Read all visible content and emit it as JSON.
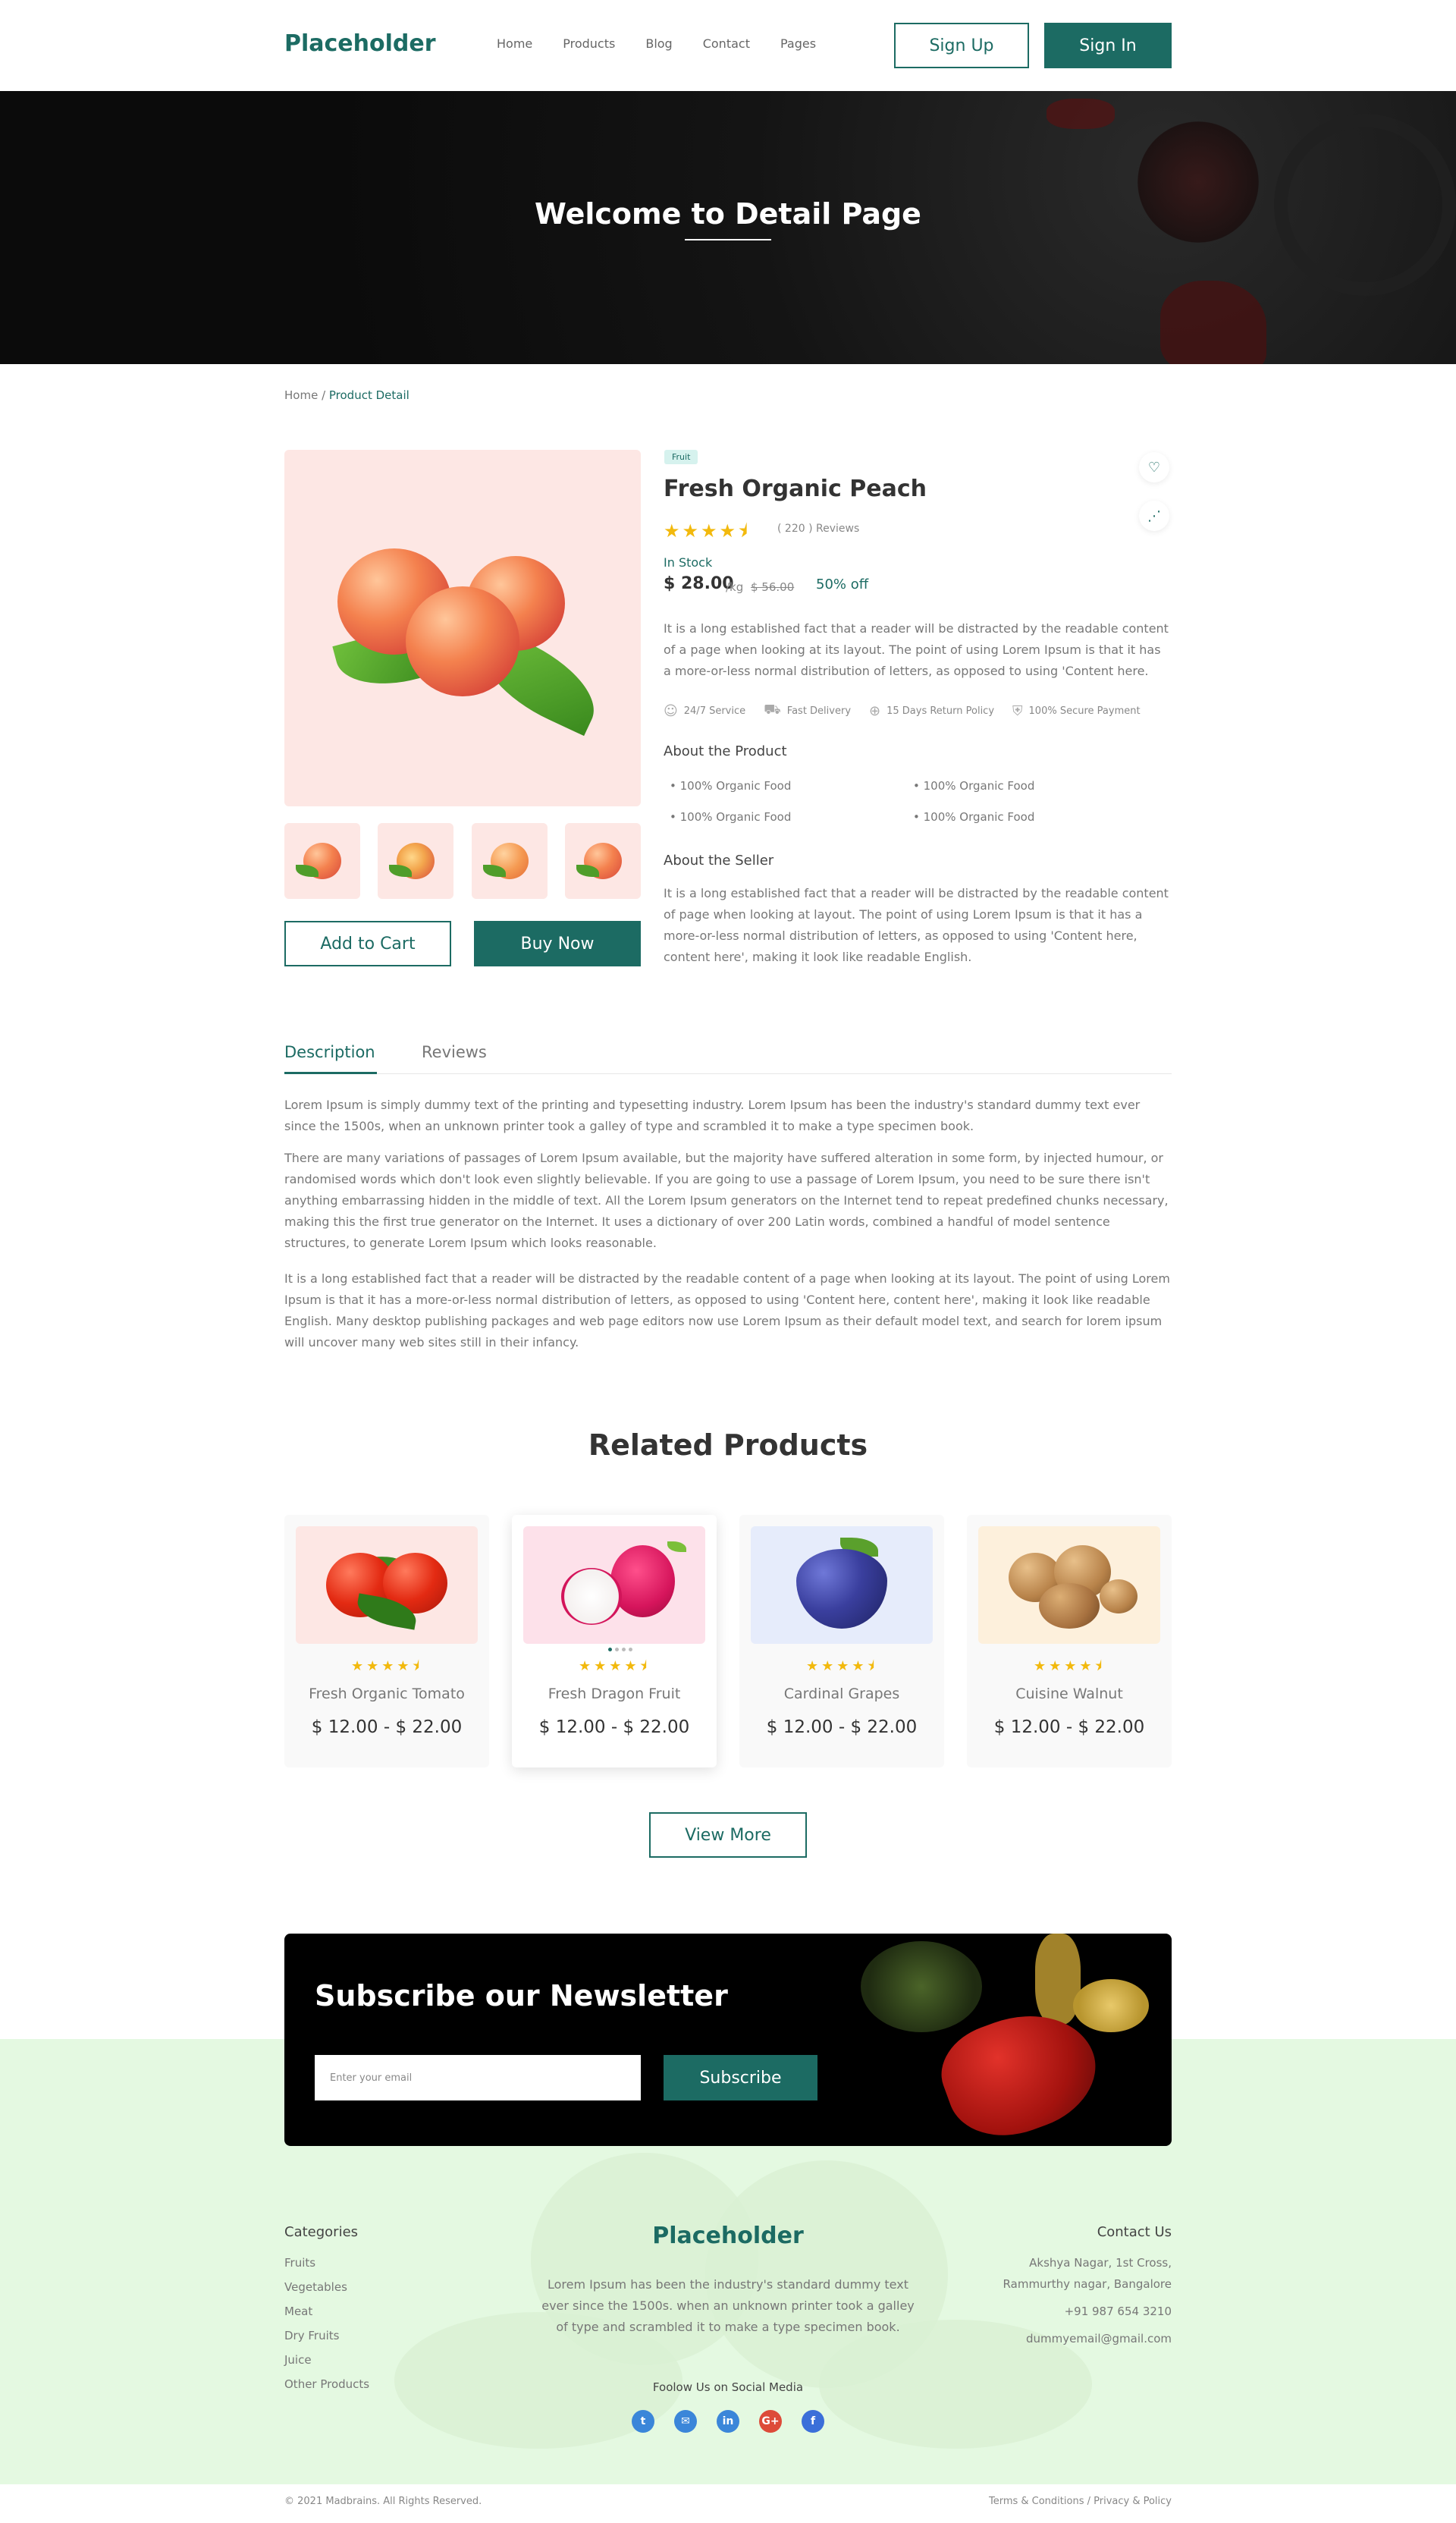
{
  "header": {
    "logo": "Placeholder",
    "nav": [
      "Home",
      "Products",
      "Blog",
      "Contact",
      "Pages"
    ],
    "signup": "Sign Up",
    "signin": "Sign In"
  },
  "hero": {
    "title": "Welcome to Detail Page"
  },
  "breadcrumb": {
    "home": "Home",
    "sep": " / ",
    "current": "Product Detail"
  },
  "product": {
    "tag": "Fruit",
    "name": "Fresh Organic Peach",
    "rating": 4.5,
    "stars": "★★★★⯨",
    "reviews": "( 220 ) Reviews",
    "stock": "In Stock",
    "price": "$ 28.00",
    "unit": "/kg",
    "old_price": "$ 56.00",
    "discount": "50% off",
    "description": "It is a long established fact that a reader will be distracted by the readable content of a page when looking at its layout. The point of using Lorem Ipsum is that it has a more-or-less normal distribution of letters, as opposed to using 'Content here.",
    "features": [
      "24/7 Service",
      "Fast Delivery",
      "15 Days Return Policy",
      "100% Secure Payment"
    ],
    "about_product_title": "About the Product",
    "about_product_items": [
      "100% Organic Food",
      "100% Organic Food",
      "100% Organic Food",
      "100% Organic Food"
    ],
    "about_seller_title": "About the Seller",
    "about_seller_text": "It is a long established fact that a reader will be distracted by the readable content of page when looking at layout. The point of using Lorem Ipsum is that it has a more-or-less normal distribution of letters, as opposed to using 'Content here, content here', making it look like readable English.",
    "add_to_cart": "Add to Cart",
    "buy_now": "Buy Now"
  },
  "tabs": {
    "description": "Description",
    "reviews": "Reviews",
    "paragraphs": [
      "Lorem Ipsum is simply dummy text of the printing and typesetting industry. Lorem Ipsum has been the industry's standard dummy text ever since the 1500s, when an unknown printer took a galley of type and scrambled it to make a type specimen book.",
      "There are many variations of passages of Lorem Ipsum available, but the majority have suffered alteration in some form, by injected humour, or randomised words which don't look even slightly believable. If you are going to use a passage of Lorem Ipsum, you need to be sure there isn't anything embarrassing hidden in the middle of text. All the Lorem Ipsum generators on the Internet tend to repeat predefined chunks necessary, making this the first true generator on the Internet. It uses a dictionary of over 200 Latin words, combined a handful of model sentence structures, to generate Lorem Ipsum which looks reasonable.",
      "It is a long established fact that a reader will be distracted by the readable content of a page when looking at its layout. The point of using Lorem Ipsum is that it has a more-or-less normal distribution of letters, as opposed to using 'Content here, content here', making it look like readable English. Many desktop publishing packages and web page editors now use Lorem Ipsum as their default model text, and search for lorem ipsum will uncover many web sites still in their infancy."
    ]
  },
  "related": {
    "title": "Related Products",
    "items": [
      {
        "name": "Fresh Organic Tomato",
        "price": "$ 12.00 - $ 22.00",
        "stars": "★★★★⯨",
        "bg": "#fde7e4"
      },
      {
        "name": "Fresh Dragon Fruit",
        "price": "$ 12.00 - $ 22.00",
        "stars": "★★★★⯨",
        "bg": "#fde1ea"
      },
      {
        "name": "Cardinal Grapes",
        "price": "$ 12.00 - $ 22.00",
        "stars": "★★★★⯨",
        "bg": "#e6ecfb"
      },
      {
        "name": "Cuisine Walnut",
        "price": "$ 12.00 - $ 22.00",
        "stars": "★★★★⯨",
        "bg": "#fdf0dc"
      }
    ],
    "view_more": "View More"
  },
  "newsletter": {
    "title": "Subscribe our Newsletter",
    "placeholder": "Enter your email",
    "button": "Subscribe"
  },
  "footer": {
    "categories_title": "Categories",
    "categories": [
      "Fruits",
      "Vegetables",
      "Meat",
      "Dry Fruits",
      "Juice",
      "Other Products"
    ],
    "logo": "Placeholder",
    "description": "Lorem Ipsum has been the industry's standard dummy text ever since the 1500s. when an unknown printer took a galley of type and scrambled it to make a type specimen book.",
    "social_title": "Foolow Us on Social Media",
    "contact_title": "Contact Us",
    "address1": "Akshya Nagar, 1st Cross,",
    "address2": "Rammurthy nagar, Bangalore",
    "phone": "+91 987 654 3210",
    "email": "dummyemail@gmail.com",
    "copyright": "© 2021 Madbrains. All Rights Reserved.",
    "terms": "Terms & Conditions",
    "legal_sep": " / ",
    "privacy": "Privacy & Policy"
  },
  "colors": {
    "brand": "#1c6b63",
    "star": "#f2b90d",
    "footer_bg": "#e4f9e1"
  },
  "icons": [
    "heart-icon",
    "share-icon",
    "service-icon",
    "delivery-icon",
    "return-icon",
    "payment-icon",
    "twitter-icon",
    "mail-icon",
    "linkedin-icon",
    "google-plus-icon",
    "facebook-icon"
  ]
}
